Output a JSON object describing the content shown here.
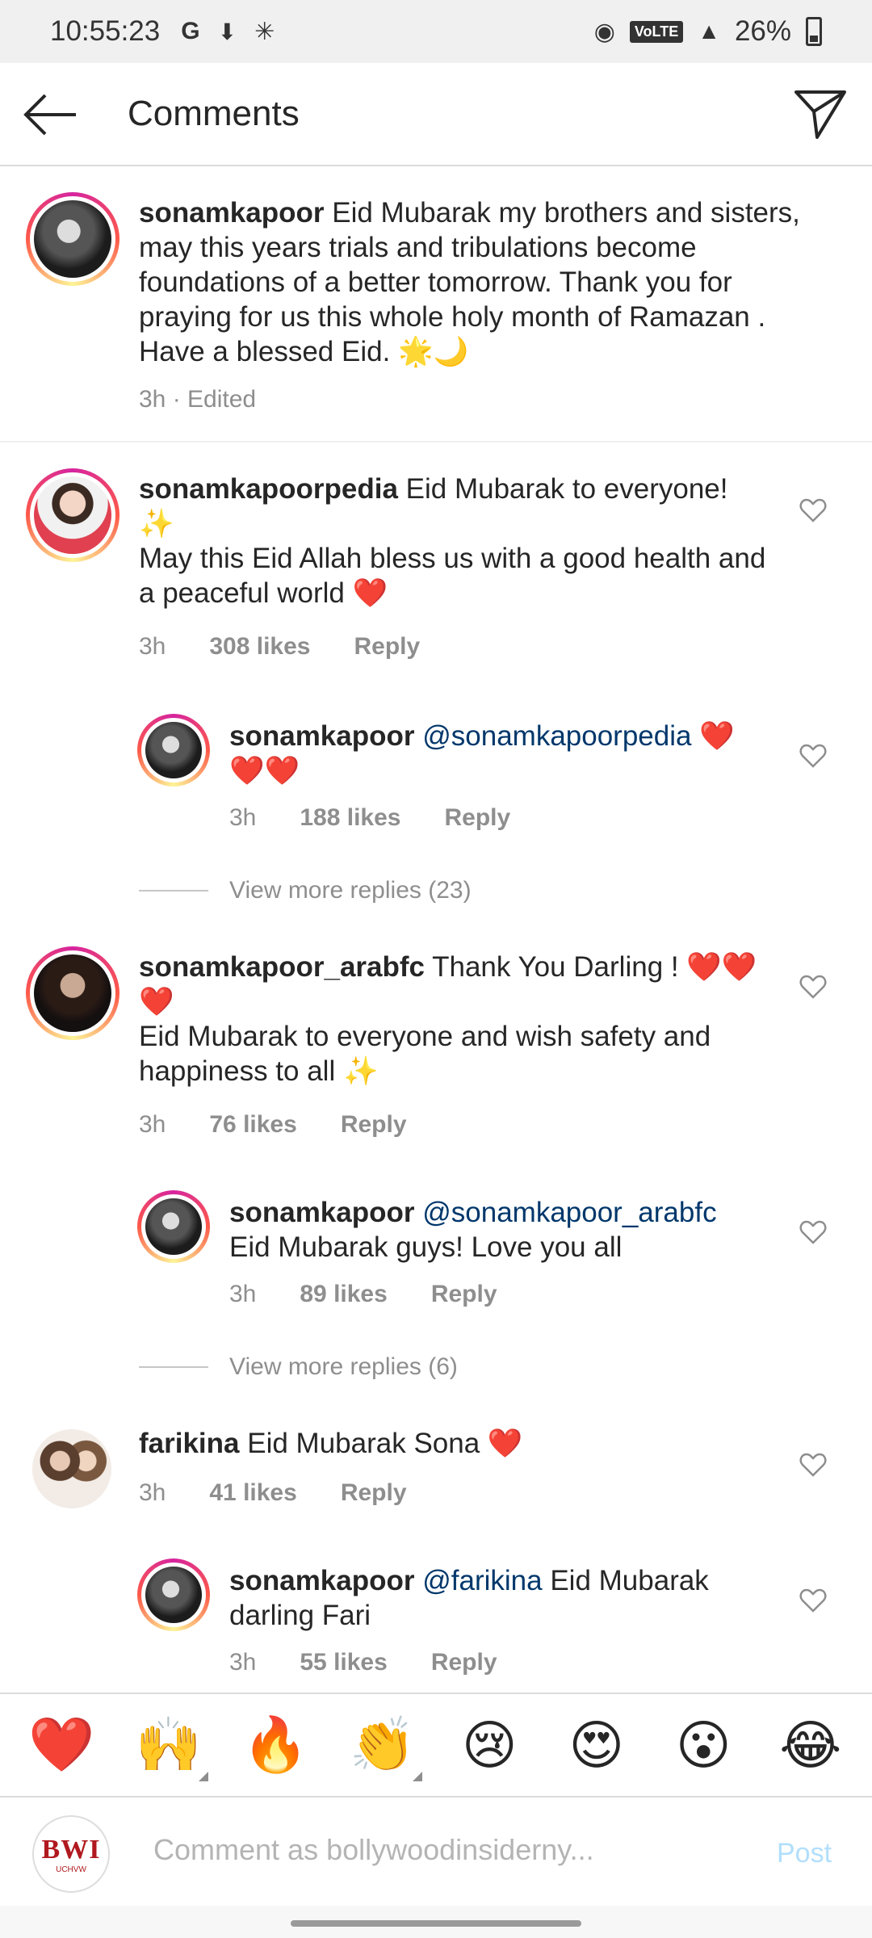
{
  "status_bar": {
    "time": "10:55:23",
    "network": "VoLTE",
    "signal": "4G",
    "battery": "26%"
  },
  "header": {
    "title": "Comments"
  },
  "caption": {
    "username": "sonamkapoor",
    "text": "Eid Mubarak my brothers and sisters, may this years trials and tribulations become foundations of a better tomorrow. Thank you for praying for us this whole holy month of Ramazan . Have a blessed Eid. 🌟🌙",
    "meta": "3h · Edited"
  },
  "comments": [
    {
      "username": "sonamkapoorpedia",
      "text_line1": "Eid Mubarak to everyone!",
      "text_line2": "✨",
      "text_line3": "May this Eid Allah bless us with a good health and a peaceful world ❤️",
      "time": "3h",
      "likes": "308 likes",
      "reply": "Reply"
    },
    {
      "username": "sonamkapoor",
      "mention": "@sonamkapoorpedia",
      "text": "❤️",
      "text_line2": "❤️❤️",
      "time": "3h",
      "likes": "188 likes",
      "reply": "Reply"
    },
    {
      "view_more": "View more replies (23)"
    },
    {
      "username": "sonamkapoor_arabfc",
      "text_line1": "Thank You Darling ! ❤️❤️",
      "text_line2": "❤️",
      "text_line3": "Eid Mubarak to everyone and wish safety and happiness to all ✨",
      "time": "3h",
      "likes": "76 likes",
      "reply": "Reply"
    },
    {
      "username": "sonamkapoor",
      "mention": "@sonamkapoor_arabfc",
      "text_line2": "Eid Mubarak guys! Love you all",
      "time": "3h",
      "likes": "89 likes",
      "reply": "Reply"
    },
    {
      "view_more": "View more replies (6)"
    },
    {
      "username": "farikina",
      "text": "Eid Mubarak Sona ❤️",
      "time": "3h",
      "likes": "41 likes",
      "reply": "Reply"
    },
    {
      "username": "sonamkapoor",
      "mention": "@farikina",
      "text": "Eid Mubarak",
      "text_line2": "darling Fari",
      "time": "3h",
      "likes": "55 likes",
      "reply": "Reply"
    }
  ],
  "reactions": [
    "❤️",
    "🙌",
    "🔥",
    "👏",
    "😢",
    "😍",
    "😮",
    "😂"
  ],
  "composer": {
    "avatar_logo": "BWI",
    "avatar_sub": "UCHVW",
    "placeholder": "Comment as bollywoodinsiderny...",
    "post_label": "Post"
  }
}
